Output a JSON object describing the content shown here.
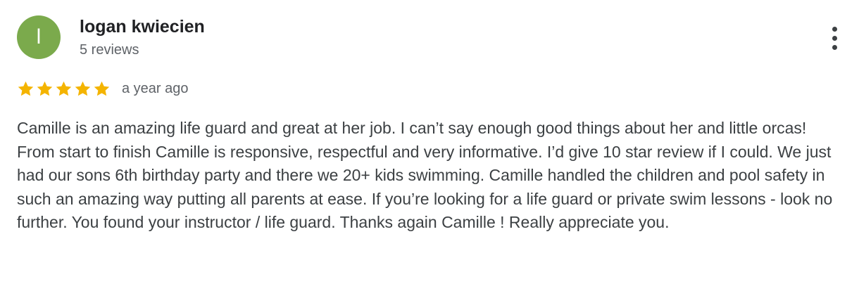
{
  "review": {
    "author": {
      "initial": "l",
      "name": "logan kwiecien",
      "review_count": "5 reviews",
      "avatar_color": "#7baa4c"
    },
    "rating": {
      "stars": 5,
      "max": 5,
      "star_color": "#f4b400"
    },
    "date": "a year ago",
    "text": "Camille is an amazing life guard and great at her job. I can’t say enough good things about her and little orcas! From start to finish Camille is responsive, respectful and very informative. I’d give 10 star review if I could. We just had our sons 6th birthday party and there we 20+ kids swimming. Camille handled the children and pool safety in such an amazing way putting all parents at ease. If you’re looking for a life guard or private swim lessons - look no further. You found your instructor / life guard. Thanks again Camille ! Really appreciate you.",
    "menu_icon": "more-vertical-icon"
  }
}
